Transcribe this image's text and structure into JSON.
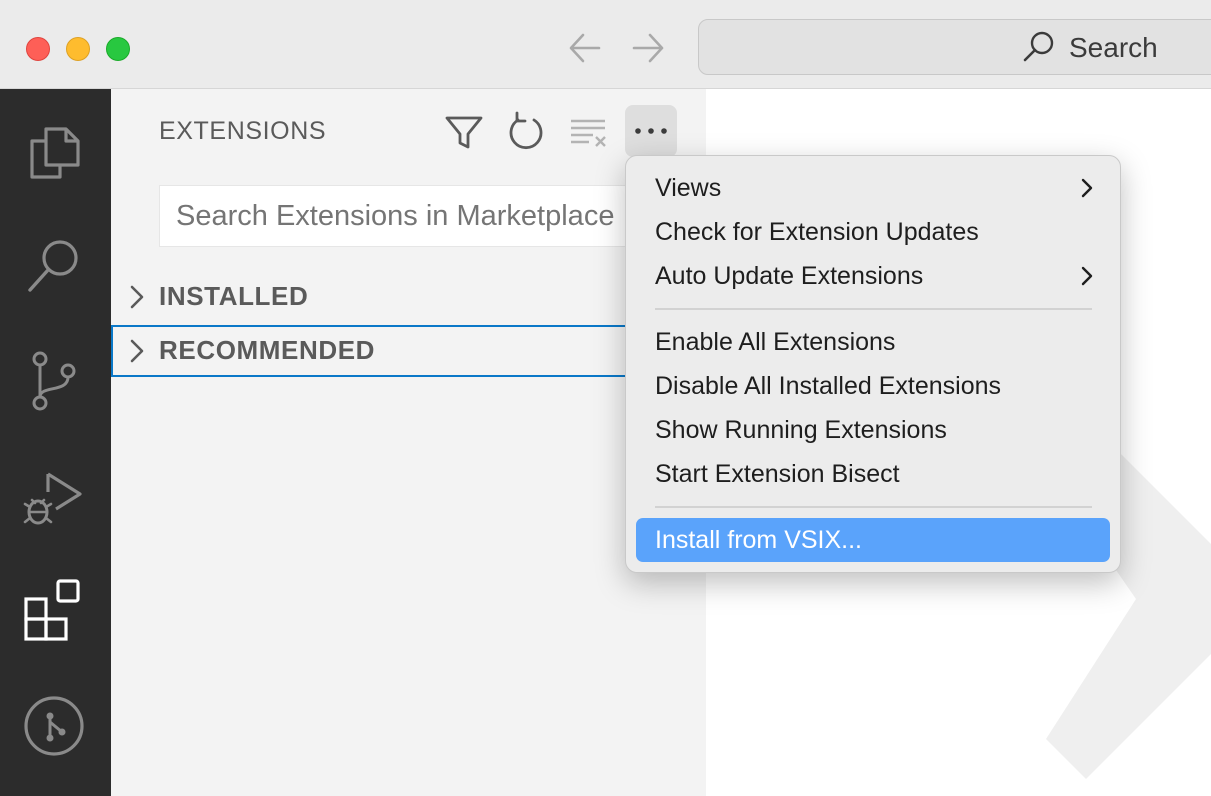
{
  "titlebar": {
    "search_label": "Search"
  },
  "sidebar": {
    "title": "EXTENSIONS",
    "search_placeholder": "Search Extensions in Marketplace",
    "sections": [
      {
        "label": "INSTALLED"
      },
      {
        "label": "RECOMMENDED"
      }
    ]
  },
  "activitybar": {
    "items": [
      {
        "icon": "files-icon"
      },
      {
        "icon": "search-icon"
      },
      {
        "icon": "source-control-icon"
      },
      {
        "icon": "run-debug-icon"
      },
      {
        "icon": "extensions-icon",
        "active": true
      },
      {
        "icon": "remote-explorer-icon"
      }
    ]
  },
  "context_menu": {
    "items": [
      {
        "label": "Views",
        "submenu": true
      },
      {
        "label": "Check for Extension Updates"
      },
      {
        "label": "Auto Update Extensions",
        "submenu": true
      },
      {
        "label": "Enable All Extensions"
      },
      {
        "label": "Disable All Installed Extensions"
      },
      {
        "label": "Show Running Extensions"
      },
      {
        "label": "Start Extension Bisect"
      },
      {
        "label": "Install from VSIX...",
        "highlighted": true
      }
    ]
  },
  "colors": {
    "accent": "#5aa3fb",
    "focus_border": "#0a78c8",
    "activitybar_bg": "#2c2c2c",
    "sidebar_bg": "#f3f3f3"
  }
}
